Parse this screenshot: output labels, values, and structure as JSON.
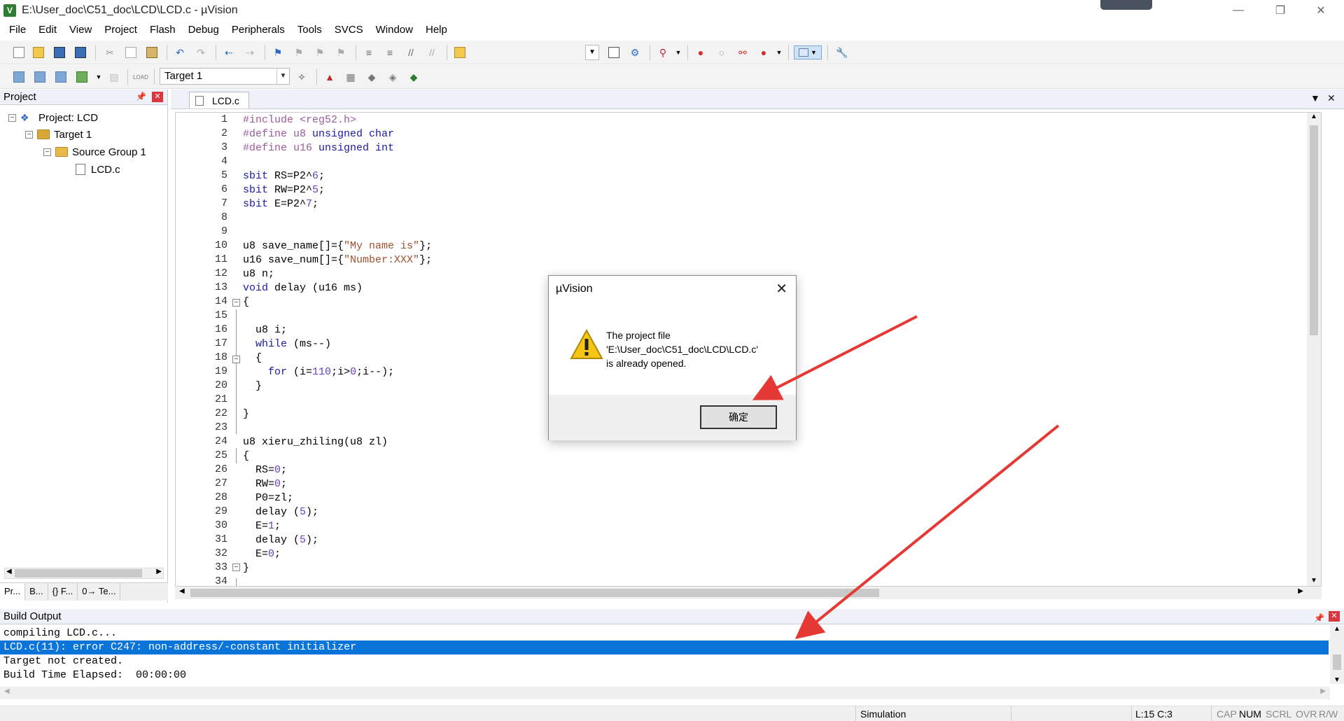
{
  "window": {
    "title": "E:\\User_doc\\C51_doc\\LCD\\LCD.c - µVision",
    "app_icon": "V"
  },
  "menu": [
    "File",
    "Edit",
    "View",
    "Project",
    "Flash",
    "Debug",
    "Peripherals",
    "Tools",
    "SVCS",
    "Window",
    "Help"
  ],
  "toolbar": {
    "target": "Target 1"
  },
  "project_panel": {
    "title": "Project",
    "tree": {
      "project": "Project: LCD",
      "target": "Target 1",
      "group": "Source Group 1",
      "file": "LCD.c"
    },
    "tabs": [
      "Pr...",
      "B...",
      "{} F...",
      "0→ Te..."
    ]
  },
  "editor": {
    "tab": "LCD.c",
    "line_numbers": [
      "1",
      "2",
      "3",
      "4",
      "5",
      "6",
      "7",
      "8",
      "9",
      "10",
      "11",
      "12",
      "13",
      "14",
      "15",
      "16",
      "17",
      "18",
      "19",
      "20",
      "21",
      "22",
      "23",
      "24",
      "25",
      "26",
      "27",
      "28",
      "29",
      "30",
      "31",
      "32",
      "33",
      "34"
    ]
  },
  "build_output": {
    "title": "Build Output",
    "lines": [
      "compiling LCD.c...",
      "LCD.c(11): error C247: non-address/-constant initializer",
      "Target not created.",
      "Build Time Elapsed:  00:00:00"
    ]
  },
  "statusbar": {
    "mode": "Simulation",
    "position": "L:15 C:3",
    "indicators": [
      "CAP",
      "NUM",
      "SCRL",
      "OVR",
      "R/W"
    ]
  },
  "dialog": {
    "title": "µVision",
    "message": [
      "The project file",
      "'E:\\User_doc\\C51_doc\\LCD\\LCD.c'",
      "is already opened."
    ],
    "ok_label": "确定"
  },
  "colors": {
    "selection": "#0a74d8",
    "keyword": "#1a1aa6",
    "preprocessor": "#9c5a9c",
    "number": "#6a3ec7",
    "string": "#a0522d",
    "arrow": "#e53935"
  }
}
